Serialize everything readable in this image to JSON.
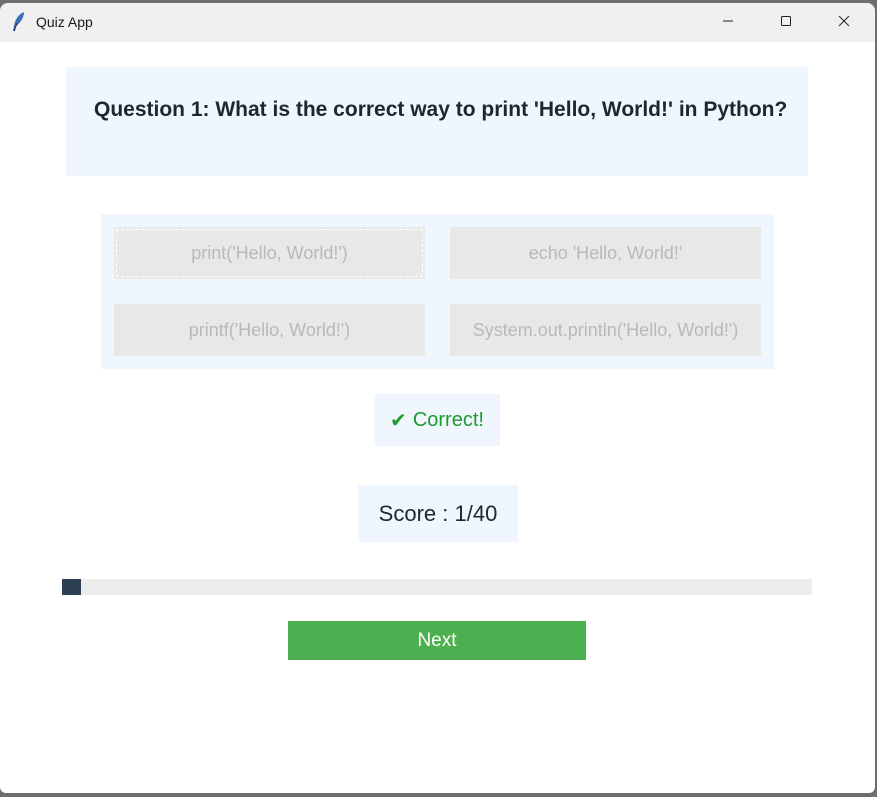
{
  "window": {
    "title": "Quiz App",
    "icon": "feather-icon"
  },
  "question": {
    "text": "Question 1: What is the correct way to print 'Hello, World!' in Python?"
  },
  "options": [
    {
      "label": "print('Hello, World!')"
    },
    {
      "label": "echo 'Hello, World!'"
    },
    {
      "label": "printf('Hello, World!')"
    },
    {
      "label": "System.out.println('Hello, World!')"
    }
  ],
  "feedback": {
    "icon": "checkmark-icon",
    "text": "Correct!",
    "color": "#1e9a2e"
  },
  "score": {
    "text": "Score : 1/40"
  },
  "progress": {
    "current": 1,
    "total": 40,
    "color": "#2c3e50"
  },
  "next_button": {
    "label": "Next",
    "color": "#4caf50"
  }
}
